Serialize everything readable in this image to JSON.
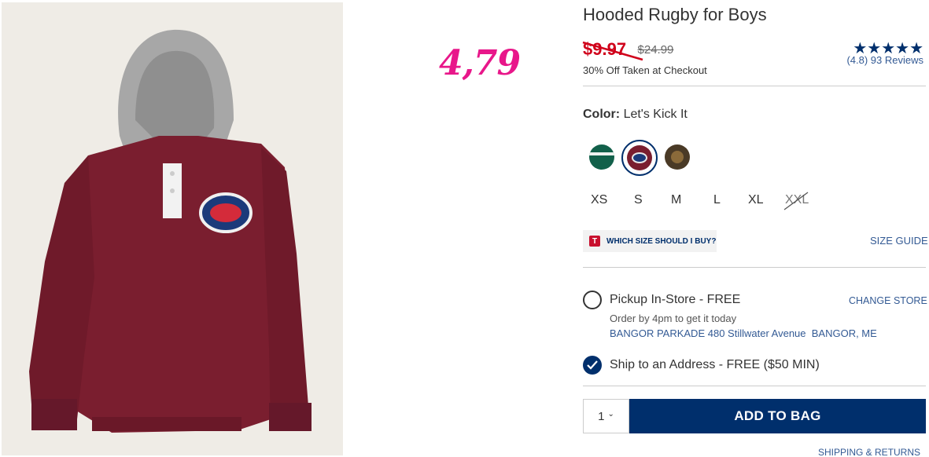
{
  "annotation": {
    "price_note": "4,79"
  },
  "product": {
    "title": "Hooded Rugby for Boys",
    "sale_price": "$9.97",
    "original_price": "$24.99",
    "discount_note": "30% Off Taken at Checkout",
    "image_icon": "hooded-rugby-shirt-image"
  },
  "rating": {
    "stars": "★★★★★",
    "reviews_text": "(4.8) 93 Reviews",
    "value": 4.8,
    "count": 93
  },
  "color": {
    "label": "Color:",
    "value": "Let's Kick It",
    "swatches": [
      {
        "name": "green-stripe",
        "hex": "#12604a"
      },
      {
        "name": "lets-kick-it",
        "hex": "#7a1e2f",
        "selected": true
      },
      {
        "name": "brown-patch",
        "hex": "#4a3a26"
      }
    ]
  },
  "sizes": [
    {
      "label": "XS",
      "available": true
    },
    {
      "label": "S",
      "available": true
    },
    {
      "label": "M",
      "available": true
    },
    {
      "label": "L",
      "available": true
    },
    {
      "label": "XL",
      "available": true
    },
    {
      "label": "XXL",
      "available": false
    }
  ],
  "size_help": {
    "badge": "T",
    "which_size": "WHICH SIZE SHOULD I BUY?",
    "size_guide": "SIZE GUIDE"
  },
  "fulfillment": {
    "pickup_label": "Pickup In-Store - FREE",
    "change_store": "CHANGE STORE",
    "order_by": "Order by 4pm to get it today",
    "store_address": "BANGOR PARKADE 480 Stillwater Avenue  BANGOR, ME",
    "ship_label": "Ship to an Address - FREE ($50 MIN)",
    "selected": "ship"
  },
  "cart": {
    "quantity": "1",
    "add_to_bag": "ADD TO BAG"
  },
  "footer": {
    "shipping_returns": "SHIPPING & RETURNS"
  },
  "colors": {
    "brand_navy": "#002f6c",
    "sale_red": "#d0021b",
    "annotation_pink": "#e8178a",
    "link_blue": "#335a94"
  }
}
